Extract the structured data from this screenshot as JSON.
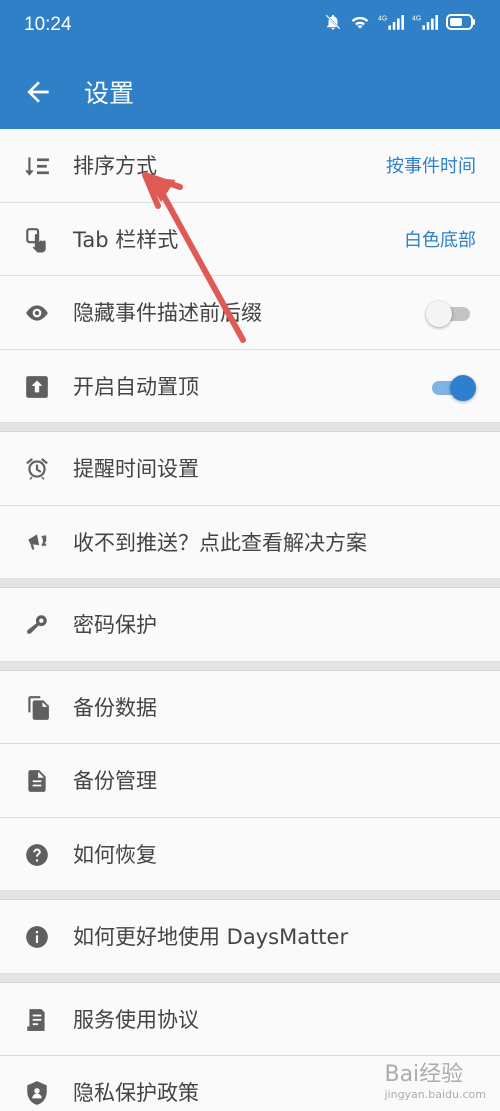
{
  "status_bar": {
    "time": "10:24"
  },
  "header": {
    "title": "设置"
  },
  "groups": [
    [
      {
        "name": "sort-mode",
        "icon": "sort-icon",
        "label": "排序方式",
        "value": "按事件时间"
      },
      {
        "name": "tab-style",
        "icon": "touch-icon",
        "label": "Tab 栏样式",
        "value": "白色底部"
      },
      {
        "name": "hide-affix",
        "icon": "eye-icon",
        "label": "隐藏事件描述前后缀",
        "toggle": false
      },
      {
        "name": "auto-pin",
        "icon": "pin-top-icon",
        "label": "开启自动置顶",
        "toggle": true
      }
    ],
    [
      {
        "name": "reminder-time",
        "icon": "alarm-icon",
        "label": "提醒时间设置"
      },
      {
        "name": "push-help",
        "icon": "alert-bell-icon",
        "label": "收不到推送？点此查看解决方案"
      }
    ],
    [
      {
        "name": "password",
        "icon": "key-icon",
        "label": "密码保护"
      }
    ],
    [
      {
        "name": "backup-data",
        "icon": "copy-icon",
        "label": "备份数据"
      },
      {
        "name": "backup-manage",
        "icon": "file-icon",
        "label": "备份管理"
      },
      {
        "name": "restore-help",
        "icon": "help-icon",
        "label": "如何恢复"
      }
    ],
    [
      {
        "name": "usage-help",
        "icon": "info-icon",
        "label": "如何更好地使用 DaysMatter"
      }
    ],
    [
      {
        "name": "service-agreement",
        "icon": "document-icon",
        "label": "服务使用协议"
      },
      {
        "name": "privacy-policy",
        "icon": "shield-icon",
        "label": "隐私保护政策"
      }
    ]
  ],
  "watermark": {
    "text": "Bai经验",
    "sub": "jingyan.baidu.com"
  },
  "colors": {
    "primary": "#2f80c7",
    "icon": "#5f5f5f",
    "value": "#2f80c7",
    "annotation": "#e05a55"
  }
}
